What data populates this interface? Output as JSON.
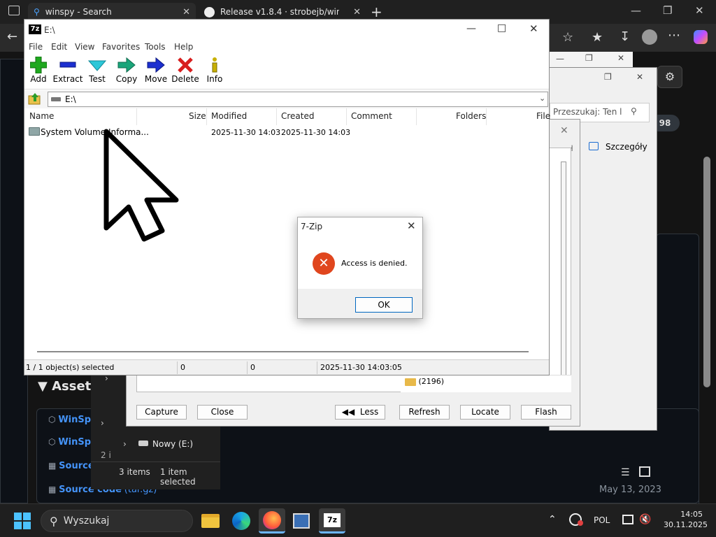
{
  "browser": {
    "tabs": [
      {
        "label": "winspy - Search"
      },
      {
        "label": "Release v1.8.4 · strobejb/winspy"
      }
    ]
  },
  "webpage": {
    "badge": "98",
    "assets_heading": "Assets",
    "assets": [
      {
        "label": "WinSp"
      },
      {
        "label": "WinSp"
      },
      {
        "label": "Source co"
      },
      {
        "label": "Source code",
        "suffix": "(tar.gz)",
        "date": "May 13, 2023"
      }
    ]
  },
  "explorer": {
    "tree_item": "Nowy (E:)",
    "tree_prefix": "2 i",
    "status_items": "3 items",
    "status_selected": "1 item selected"
  },
  "winspy": {
    "search_placeholder": "Przeszukaj: Ten l",
    "details_label": "Szczegóły",
    "folder_count": "(2196)",
    "buttons": {
      "capture": "Capture",
      "close": "Close",
      "less": "Less",
      "refresh": "Refresh",
      "locate": "Locate",
      "flash": "Flash"
    }
  },
  "sevenzip": {
    "title": "E:\\",
    "menu": [
      "File",
      "Edit",
      "View",
      "Favorites",
      "Tools",
      "Help"
    ],
    "toolbar": [
      "Add",
      "Extract",
      "Test",
      "Copy",
      "Move",
      "Delete",
      "Info"
    ],
    "address": "E:\\",
    "columns": [
      "Name",
      "Size",
      "Modified",
      "Created",
      "Comment",
      "Folders",
      "File"
    ],
    "rows": [
      {
        "name": "System Volume Informa...",
        "modified": "2025-11-30 14:03",
        "created": "2025-11-30 14:03"
      }
    ],
    "status": {
      "selected": "1 / 1 object(s) selected",
      "size": "0",
      "packed": "0",
      "date": "2025-11-30 14:03:05"
    }
  },
  "dialog": {
    "title": "7-Zip",
    "message": "Access is denied.",
    "ok_label": "OK"
  },
  "taskbar": {
    "search_label": "Wyszukaj",
    "language": "POL",
    "time": "14:05",
    "date": "30.11.2025"
  },
  "colors": {
    "dialog_error": "#e0461e",
    "ok_border": "#0067c0",
    "github_link": "#4493f8"
  }
}
